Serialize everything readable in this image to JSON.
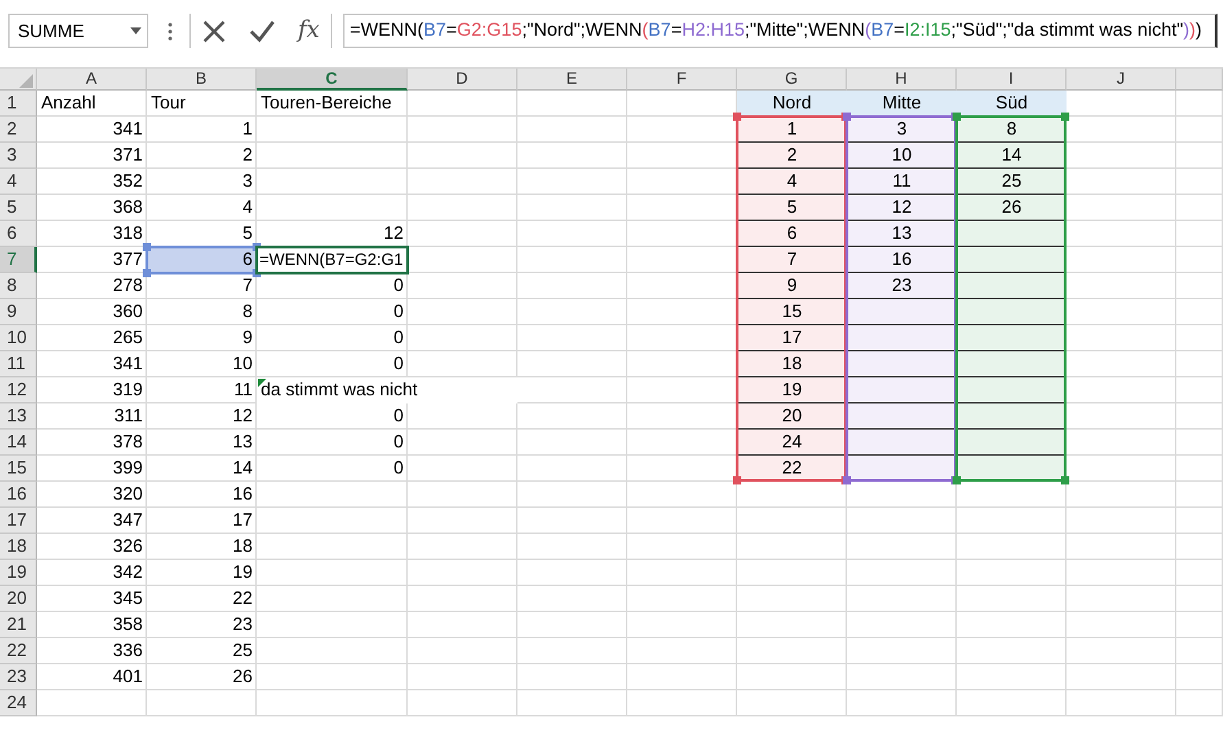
{
  "formula_bar": {
    "name_box": "SUMME",
    "function_label": "fx",
    "formula": [
      {
        "text": "=WENN("
      },
      {
        "text": "B7",
        "color": "#4472c4"
      },
      {
        "text": "="
      },
      {
        "text": "G2:G15",
        "color": "#e0525e"
      },
      {
        "text": ";\"Nord\";WENN"
      },
      {
        "text": "(",
        "color": "#e0525e"
      },
      {
        "text": "B7",
        "color": "#4472c4"
      },
      {
        "text": "="
      },
      {
        "text": "H2:H15",
        "color": "#8e6bd1"
      },
      {
        "text": ";\"Mitte\";WENN"
      },
      {
        "text": "(",
        "color": "#8e6bd1"
      },
      {
        "text": "B7",
        "color": "#4472c4"
      },
      {
        "text": "="
      },
      {
        "text": "I2:I15",
        "color": "#2e9e49"
      },
      {
        "text": ";\"Süd\";\"da stimmt was nicht\""
      },
      {
        "text": ")",
        "color": "#8e6bd1"
      },
      {
        "text": ")",
        "color": "#e0525e"
      },
      {
        "text": ")"
      }
    ]
  },
  "columns": [
    {
      "label": "A",
      "selected": false
    },
    {
      "label": "B",
      "selected": false
    },
    {
      "label": "C",
      "selected": true
    },
    {
      "label": "D",
      "selected": false
    },
    {
      "label": "E",
      "selected": false
    },
    {
      "label": "F",
      "selected": false
    },
    {
      "label": "G",
      "selected": false,
      "color": "#e0525e"
    },
    {
      "label": "H",
      "selected": false,
      "color": "#8e6bd1"
    },
    {
      "label": "I",
      "selected": false,
      "color": "#2e9e49"
    },
    {
      "label": "J",
      "selected": false
    }
  ],
  "rows": [
    {
      "label": "1",
      "selected": false,
      "cells": [
        {
          "kind": "text",
          "text": "Anzahl"
        },
        {
          "kind": "text",
          "text": "Tour"
        },
        {
          "kind": "text",
          "text": "Touren-Bereiche"
        },
        null,
        null,
        null,
        {
          "kind": "table-header",
          "text": "Nord"
        },
        {
          "kind": "table-header",
          "text": "Mitte"
        },
        {
          "kind": "table-header",
          "text": "Süd"
        }
      ]
    },
    {
      "label": "2",
      "selected": false,
      "cells": [
        {
          "kind": "number",
          "text": "341"
        },
        {
          "kind": "number",
          "text": "1"
        },
        null,
        null,
        null,
        null,
        {
          "kind": "table",
          "text": "1"
        },
        {
          "kind": "table",
          "text": "3"
        },
        {
          "kind": "table",
          "text": "8"
        }
      ]
    },
    {
      "label": "3",
      "selected": false,
      "cells": [
        {
          "kind": "number",
          "text": "371"
        },
        {
          "kind": "number",
          "text": "2"
        },
        null,
        null,
        null,
        null,
        {
          "kind": "table",
          "text": "2"
        },
        {
          "kind": "table",
          "text": "10"
        },
        {
          "kind": "table",
          "text": "14"
        }
      ]
    },
    {
      "label": "4",
      "selected": false,
      "cells": [
        {
          "kind": "number",
          "text": "352"
        },
        {
          "kind": "number",
          "text": "3"
        },
        null,
        null,
        null,
        null,
        {
          "kind": "table",
          "text": "4"
        },
        {
          "kind": "table",
          "text": "11"
        },
        {
          "kind": "table",
          "text": "25"
        }
      ]
    },
    {
      "label": "5",
      "selected": false,
      "cells": [
        {
          "kind": "number",
          "text": "368"
        },
        {
          "kind": "number",
          "text": "4"
        },
        null,
        null,
        null,
        null,
        {
          "kind": "table",
          "text": "5"
        },
        {
          "kind": "table",
          "text": "12"
        },
        {
          "kind": "table",
          "text": "26"
        }
      ]
    },
    {
      "label": "6",
      "selected": false,
      "cells": [
        {
          "kind": "number",
          "text": "318"
        },
        {
          "kind": "number",
          "text": "5"
        },
        {
          "kind": "number",
          "text": "12"
        },
        null,
        null,
        null,
        {
          "kind": "table",
          "text": "6"
        },
        {
          "kind": "table",
          "text": "13"
        },
        {
          "kind": "table"
        }
      ]
    },
    {
      "label": "7",
      "selected": true,
      "cells": [
        {
          "kind": "number",
          "text": "377"
        },
        {
          "kind": "number",
          "text": "6",
          "selected": true
        },
        {
          "kind": "editing",
          "text": "=WENN(B7=G2:G1"
        },
        null,
        null,
        null,
        {
          "kind": "table",
          "text": "7"
        },
        {
          "kind": "table",
          "text": "16"
        },
        {
          "kind": "table"
        }
      ]
    },
    {
      "label": "8",
      "selected": false,
      "cells": [
        {
          "kind": "number",
          "text": "278"
        },
        {
          "kind": "number",
          "text": "7"
        },
        {
          "kind": "number",
          "text": "0"
        },
        null,
        null,
        null,
        {
          "kind": "table",
          "text": "9"
        },
        {
          "kind": "table",
          "text": "23"
        },
        {
          "kind": "table"
        }
      ]
    },
    {
      "label": "9",
      "selected": false,
      "cells": [
        {
          "kind": "number",
          "text": "360"
        },
        {
          "kind": "number",
          "text": "8"
        },
        {
          "kind": "number",
          "text": "0"
        },
        null,
        null,
        null,
        {
          "kind": "table",
          "text": "15"
        },
        {
          "kind": "table"
        },
        {
          "kind": "table"
        }
      ]
    },
    {
      "label": "10",
      "selected": false,
      "cells": [
        {
          "kind": "number",
          "text": "265"
        },
        {
          "kind": "number",
          "text": "9"
        },
        {
          "kind": "number",
          "text": "0"
        },
        null,
        null,
        null,
        {
          "kind": "table",
          "text": "17"
        },
        {
          "kind": "table"
        },
        {
          "kind": "table"
        }
      ]
    },
    {
      "label": "11",
      "selected": false,
      "cells": [
        {
          "kind": "number",
          "text": "341"
        },
        {
          "kind": "number",
          "text": "10"
        },
        {
          "kind": "number",
          "text": "0"
        },
        null,
        null,
        null,
        {
          "kind": "table",
          "text": "18"
        },
        {
          "kind": "table"
        },
        {
          "kind": "table"
        }
      ]
    },
    {
      "label": "12",
      "selected": false,
      "cells": [
        {
          "kind": "number",
          "text": "319"
        },
        {
          "kind": "number",
          "text": "11"
        },
        {
          "kind": "text",
          "text": "da stimmt was nicht",
          "spill": true,
          "error_mark": true
        },
        null,
        null,
        null,
        {
          "kind": "table",
          "text": "19"
        },
        {
          "kind": "table"
        },
        {
          "kind": "table"
        }
      ]
    },
    {
      "label": "13",
      "selected": false,
      "cells": [
        {
          "kind": "number",
          "text": "311"
        },
        {
          "kind": "number",
          "text": "12"
        },
        {
          "kind": "number",
          "text": "0"
        },
        null,
        null,
        null,
        {
          "kind": "table",
          "text": "20"
        },
        {
          "kind": "table"
        },
        {
          "kind": "table"
        }
      ]
    },
    {
      "label": "14",
      "selected": false,
      "cells": [
        {
          "kind": "number",
          "text": "378"
        },
        {
          "kind": "number",
          "text": "13"
        },
        {
          "kind": "number",
          "text": "0"
        },
        null,
        null,
        null,
        {
          "kind": "table",
          "text": "24"
        },
        {
          "kind": "table"
        },
        {
          "kind": "table"
        }
      ]
    },
    {
      "label": "15",
      "selected": false,
      "cells": [
        {
          "kind": "number",
          "text": "399"
        },
        {
          "kind": "number",
          "text": "14"
        },
        {
          "kind": "number",
          "text": "0"
        },
        null,
        null,
        null,
        {
          "kind": "table",
          "text": "22"
        },
        {
          "kind": "table"
        },
        {
          "kind": "table"
        }
      ]
    },
    {
      "label": "16",
      "selected": false,
      "cells": [
        {
          "kind": "number",
          "text": "320"
        },
        {
          "kind": "number",
          "text": "16"
        }
      ]
    },
    {
      "label": "17",
      "selected": false,
      "cells": [
        {
          "kind": "number",
          "text": "347"
        },
        {
          "kind": "number",
          "text": "17"
        }
      ]
    },
    {
      "label": "18",
      "selected": false,
      "cells": [
        {
          "kind": "number",
          "text": "326"
        },
        {
          "kind": "number",
          "text": "18"
        }
      ]
    },
    {
      "label": "19",
      "selected": false,
      "cells": [
        {
          "kind": "number",
          "text": "342"
        },
        {
          "kind": "number",
          "text": "19"
        }
      ]
    },
    {
      "label": "20",
      "selected": false,
      "cells": [
        {
          "kind": "number",
          "text": "345"
        },
        {
          "kind": "number",
          "text": "22"
        }
      ]
    },
    {
      "label": "21",
      "selected": false,
      "cells": [
        {
          "kind": "number",
          "text": "358"
        },
        {
          "kind": "number",
          "text": "23"
        }
      ]
    },
    {
      "label": "22",
      "selected": false,
      "cells": [
        {
          "kind": "number",
          "text": "336"
        },
        {
          "kind": "number",
          "text": "25"
        }
      ]
    },
    {
      "label": "23",
      "selected": false,
      "cells": [
        {
          "kind": "number",
          "text": "401"
        },
        {
          "kind": "number",
          "text": "26"
        }
      ]
    },
    {
      "label": "24",
      "selected": false,
      "cells": []
    }
  ]
}
